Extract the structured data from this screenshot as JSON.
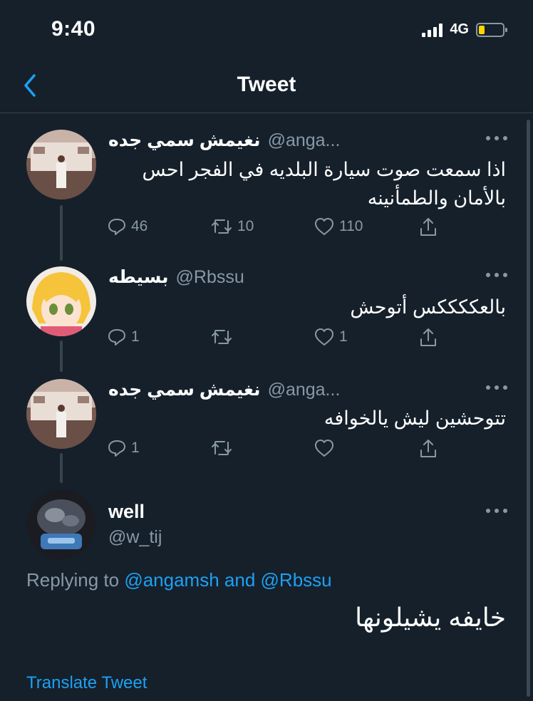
{
  "status_bar": {
    "time": "9:40",
    "network": "4G"
  },
  "nav": {
    "title": "Tweet"
  },
  "thread": [
    {
      "name": "نغيمش سمي جده",
      "handle": "@anga...",
      "text": "اذا سمعت صوت سيارة البلديه في الفجر احس بالأمان والطمأنينه",
      "replies": "46",
      "retweets": "10",
      "likes": "110"
    },
    {
      "name": "بسيطه",
      "handle": "@Rbssu",
      "text": "بالعككككس أتوحش",
      "replies": "1",
      "retweets": "",
      "likes": "1"
    },
    {
      "name": "نغيمش سمي جده",
      "handle": "@anga...",
      "text": "تتوحشين ليش يالخوافه",
      "replies": "1",
      "retweets": "",
      "likes": ""
    }
  ],
  "main_tweet": {
    "name": "well",
    "handle": "@w_tij",
    "replying_prefix": "Replying to",
    "mention_1": "@angamsh",
    "conjunction": "and",
    "mention_2": "@Rbssu",
    "text": "خايفه يشيلونها",
    "translate": "Translate Tweet"
  },
  "icons": [
    "back-chevron-icon",
    "more-icon",
    "reply-icon",
    "retweet-icon",
    "like-icon",
    "share-icon",
    "signal-icon",
    "battery-icon"
  ],
  "colors": {
    "background": "#15202b",
    "accent": "#1da1f2",
    "secondary_text": "#8899a6",
    "divider": "#38444d",
    "battery": "#ffd400"
  }
}
